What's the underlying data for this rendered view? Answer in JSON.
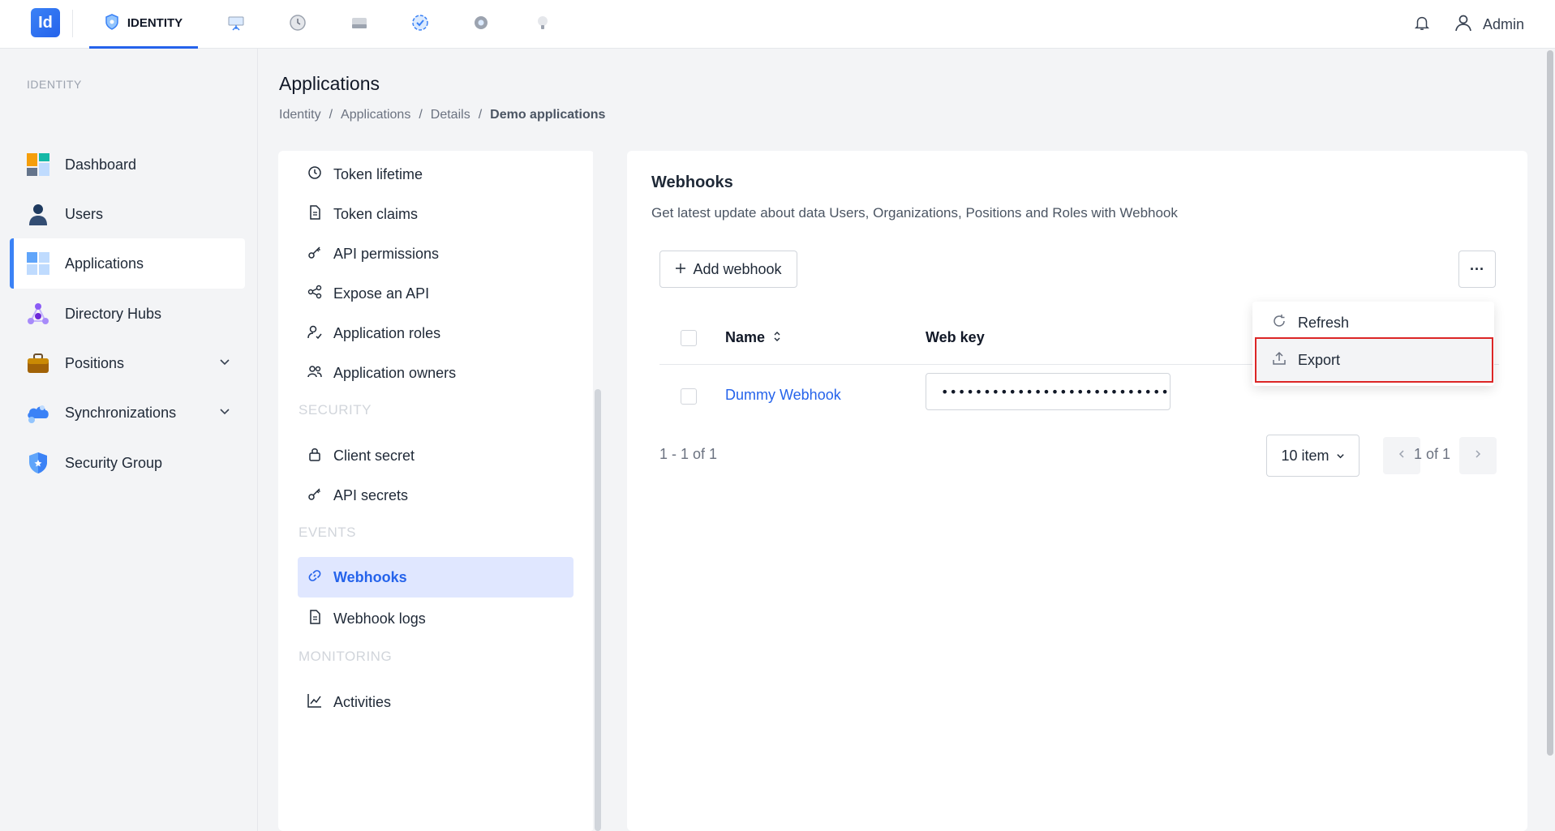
{
  "topbar": {
    "logo_text": "Id",
    "active_tab_label": "IDENTITY",
    "other_tabs": [
      "presentation-icon",
      "clock-icon",
      "drive-icon",
      "check-circle-icon",
      "settings-icon",
      "bulb-icon"
    ],
    "user_name": "Admin"
  },
  "sidebar": {
    "section_label": "IDENTITY",
    "items": [
      {
        "label": "Dashboard",
        "icon": "dashboard-icon"
      },
      {
        "label": "Users",
        "icon": "user-icon"
      },
      {
        "label": "Applications",
        "icon": "applications-icon",
        "active": true
      },
      {
        "label": "Directory Hubs",
        "icon": "hub-icon"
      },
      {
        "label": "Positions",
        "icon": "briefcase-icon",
        "expandable": true
      },
      {
        "label": "Synchronizations",
        "icon": "cloud-sync-icon",
        "expandable": true
      },
      {
        "label": "Security Group",
        "icon": "shield-icon"
      }
    ]
  },
  "page": {
    "title": "Applications",
    "breadcrumb": [
      "Identity",
      "Applications",
      "Details",
      "Demo applications"
    ]
  },
  "settings_panel": {
    "items_top": [
      {
        "label": "Token lifetime",
        "icon": "clock-icon"
      },
      {
        "label": "Token claims",
        "icon": "document-icon"
      },
      {
        "label": "API permissions",
        "icon": "key-icon"
      },
      {
        "label": "Expose an API",
        "icon": "share-icon"
      },
      {
        "label": "Application roles",
        "icon": "user-role-icon"
      },
      {
        "label": "Application owners",
        "icon": "users-icon"
      }
    ],
    "section_security": "SECURITY",
    "items_security": [
      {
        "label": "Client secret",
        "icon": "lock-icon"
      },
      {
        "label": "API secrets",
        "icon": "key-icon"
      }
    ],
    "section_events": "EVENTS",
    "items_events": [
      {
        "label": "Webhooks",
        "icon": "link-icon",
        "active": true
      },
      {
        "label": "Webhook logs",
        "icon": "document-icon"
      }
    ],
    "section_monitoring": "MONITORING",
    "items_monitoring": [
      {
        "label": "Activities",
        "icon": "chart-line-icon"
      }
    ]
  },
  "webhooks": {
    "title": "Webhooks",
    "subtitle": "Get latest update about data Users, Organizations, Positions and Roles with Webhook",
    "add_button": "Add webhook",
    "more_button": "···",
    "columns": {
      "name": "Name",
      "web_key": "Web key"
    },
    "rows": [
      {
        "name": "Dummy Webhook",
        "web_key": "••••••••••••••••••••••••••••"
      }
    ],
    "range_text": "1 - 1 of 1",
    "page_size": "10 item",
    "page_text": "1 of 1"
  },
  "more_menu": {
    "items": [
      {
        "label": "Refresh",
        "icon": "refresh-icon"
      },
      {
        "label": "Export",
        "icon": "upload-icon",
        "highlighted": true
      }
    ]
  },
  "colors": {
    "accent": "#2563eb",
    "active_bg": "#e0e7ff",
    "highlight_border": "#dc2626"
  }
}
